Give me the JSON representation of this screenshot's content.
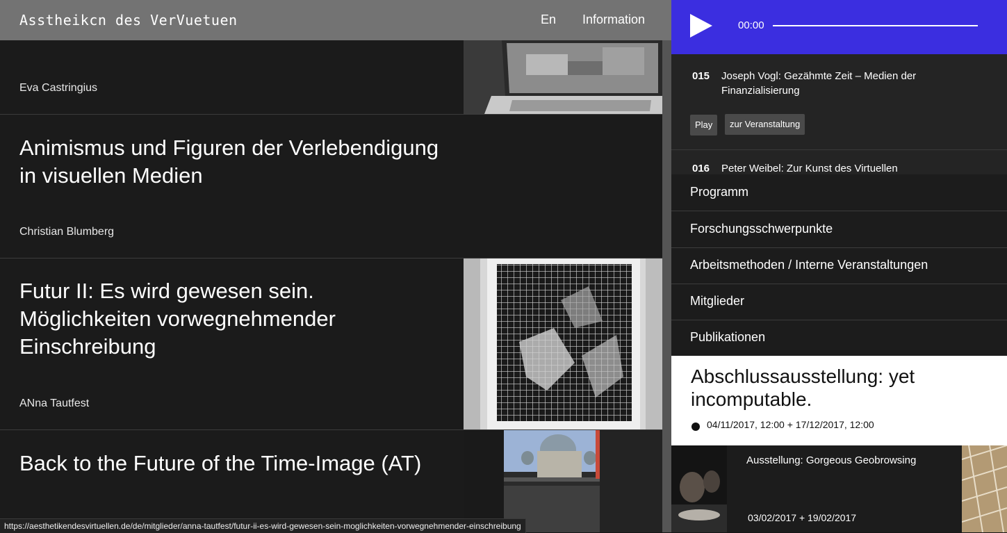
{
  "header": {
    "site_title": "Asstheikcn des VerVuetuen",
    "lang_label": "En",
    "info_label": "Information"
  },
  "entries": [
    {
      "title": "",
      "author": "Eva Castringius"
    },
    {
      "title": "Animismus und Figuren der Verlebendigung in visuellen Medien",
      "author": "Christian Blumberg"
    },
    {
      "title": "Futur II: Es wird gewesen sein. Möglichkeiten vorwegnehmender Einschreibung",
      "author": "ANna Tautfest"
    },
    {
      "title": "Back to the Future of the Time-Image (AT)",
      "author": ""
    }
  ],
  "status_url": "https://aesthetikendesvirtuellen.de/de/mitglieder/anna-tautfest/futur-ii-es-wird-gewesen-sein-moglichkeiten-vorwegnehmender-einschreibung",
  "player": {
    "time": "00:00",
    "accent_color": "#3b2ee0",
    "icon": "play-icon"
  },
  "playlist": [
    {
      "num": "015",
      "title": "Joseph Vogl: Gezähmte Zeit – Medien der Finanzialisierung",
      "play_label": "Play",
      "event_label": "zur Veranstaltung"
    },
    {
      "num": "016",
      "title": "Peter Weibel: Zur Kunst des Virtuellen"
    }
  ],
  "nav": {
    "items": [
      {
        "label": "Programm"
      },
      {
        "label": "Forschungsschwerpunkte"
      },
      {
        "label": "Arbeitsmethoden / Interne Veranstaltungen"
      },
      {
        "label": "Mitglieder"
      },
      {
        "label": "Publikationen"
      }
    ]
  },
  "feature": {
    "title": "Abschlussausstellung: yet incomputable.",
    "dates": "04/11/2017, 12:00  + 17/12/2017, 12:00"
  },
  "exhibition": {
    "title": "Ausstellung: Gorgeous Geobrowsing",
    "dates": "03/02/2017  + 19/02/2017"
  }
}
